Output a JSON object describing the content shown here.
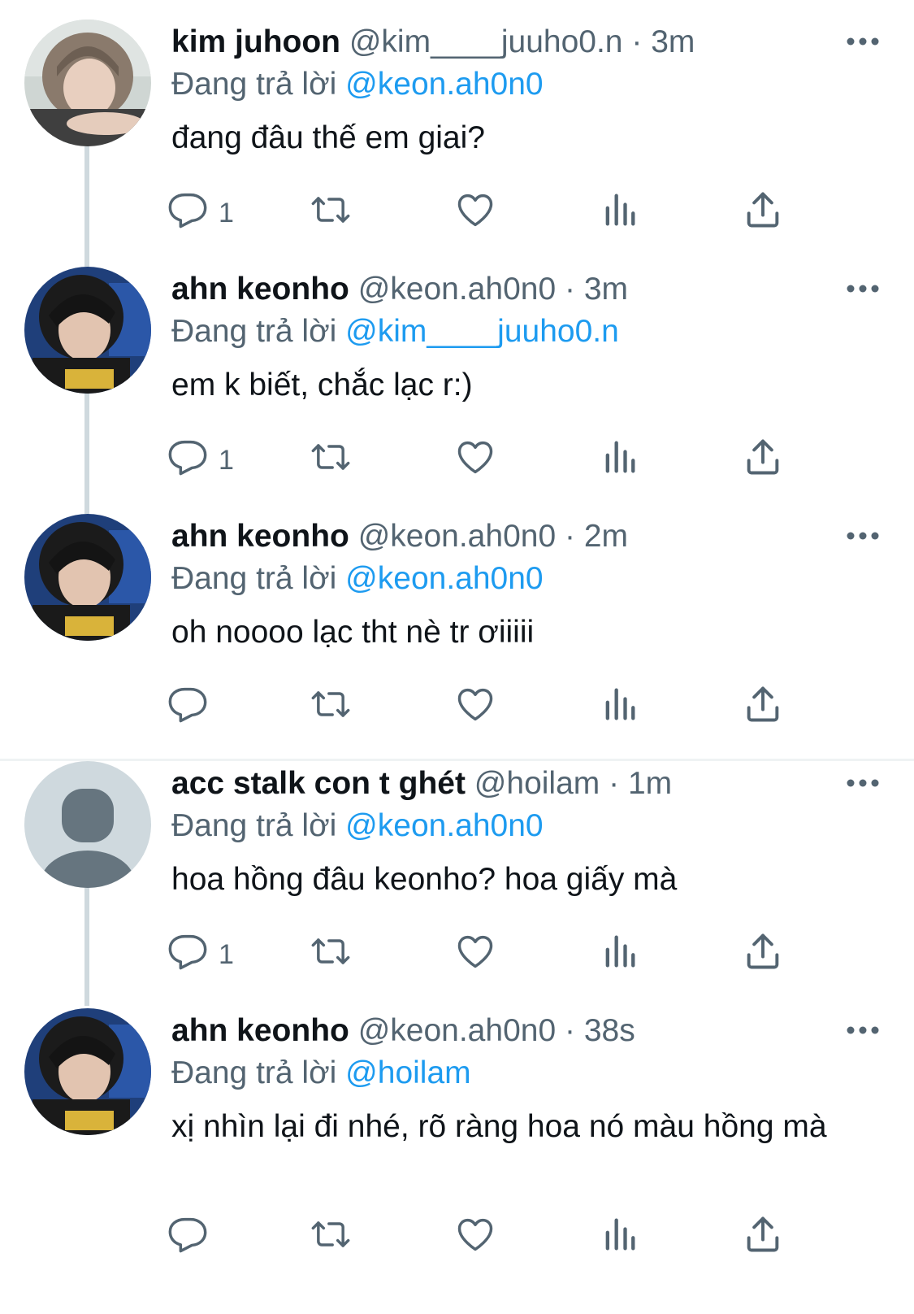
{
  "reply_prefix": "Đang trả lời",
  "tweets": [
    {
      "name": "kim juhoon",
      "handle": "@kim____juuho0.n",
      "time": "3m",
      "reply_to": "@keon.ah0n0",
      "text": "đang đâu thế em giai?",
      "reply_count": "1",
      "avatar": "photo"
    },
    {
      "name": "ahn keonho",
      "handle": "@keon.ah0n0",
      "time": "3m",
      "reply_to": "@kim____juuho0.n",
      "text": "em k biết, chắc lạc r:)",
      "reply_count": "1",
      "avatar": "photo"
    },
    {
      "name": "ahn keonho",
      "handle": "@keon.ah0n0",
      "time": "2m",
      "reply_to": "@keon.ah0n0",
      "text": "oh noooo lạc tht nè tr ơiiiii",
      "reply_count": "",
      "avatar": "photo"
    },
    {
      "name": "acc stalk con t ghét",
      "handle": "@hoilam",
      "time": "1m",
      "reply_to": "@keon.ah0n0",
      "text": "hoa hồng đâu keonho? hoa giấy mà",
      "reply_count": "1",
      "avatar": "default"
    },
    {
      "name": "ahn keonho",
      "handle": "@keon.ah0n0",
      "time": "38s",
      "reply_to": "@hoilam",
      "text": "xị nhìn lại đi nhé, rõ ràng hoa nó màu hồng mà",
      "reply_count": "",
      "avatar": "photo"
    }
  ],
  "icons": {
    "reply": "reply-icon",
    "retweet": "retweet-icon",
    "like": "like-icon",
    "views": "views-icon",
    "share": "share-icon",
    "more": "more-icon"
  },
  "colors": {
    "mention": "#1d9bf0",
    "secondary_text": "#536471",
    "primary_text": "#0f1419",
    "thread_line": "#cfd9de"
  },
  "dot": "·"
}
